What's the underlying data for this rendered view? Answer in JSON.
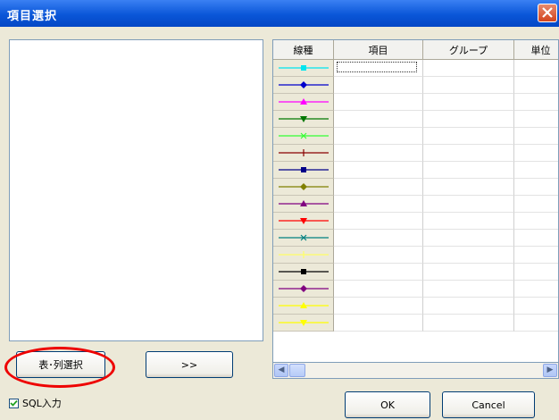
{
  "window": {
    "title": "項目選択"
  },
  "buttons": {
    "table_select": "表･列選択",
    "move": ">>",
    "ok": "OK",
    "cancel": "Cancel"
  },
  "checkbox": {
    "label": "SQL入力",
    "checked": true
  },
  "grid": {
    "headers": [
      "線種",
      "項目",
      "グループ",
      "単位"
    ],
    "line_styles": [
      {
        "color": "#00e5ee",
        "marker": "square"
      },
      {
        "color": "#0000cc",
        "marker": "diamond"
      },
      {
        "color": "#ff00ff",
        "marker": "triangle-up"
      },
      {
        "color": "#007700",
        "marker": "triangle-down"
      },
      {
        "color": "#33ff33",
        "marker": "x"
      },
      {
        "color": "#880000",
        "marker": "plus"
      },
      {
        "color": "#000088",
        "marker": "square"
      },
      {
        "color": "#808000",
        "marker": "diamond"
      },
      {
        "color": "#800080",
        "marker": "triangle-up"
      },
      {
        "color": "#ff0000",
        "marker": "triangle-down"
      },
      {
        "color": "#008080",
        "marker": "x"
      },
      {
        "color": "#ffff66",
        "marker": "plus"
      },
      {
        "color": "#000000",
        "marker": "square"
      },
      {
        "color": "#800080",
        "marker": "diamond"
      },
      {
        "color": "#ffff00",
        "marker": "triangle-up"
      },
      {
        "color": "#ffff00",
        "marker": "triangle-down"
      }
    ]
  }
}
